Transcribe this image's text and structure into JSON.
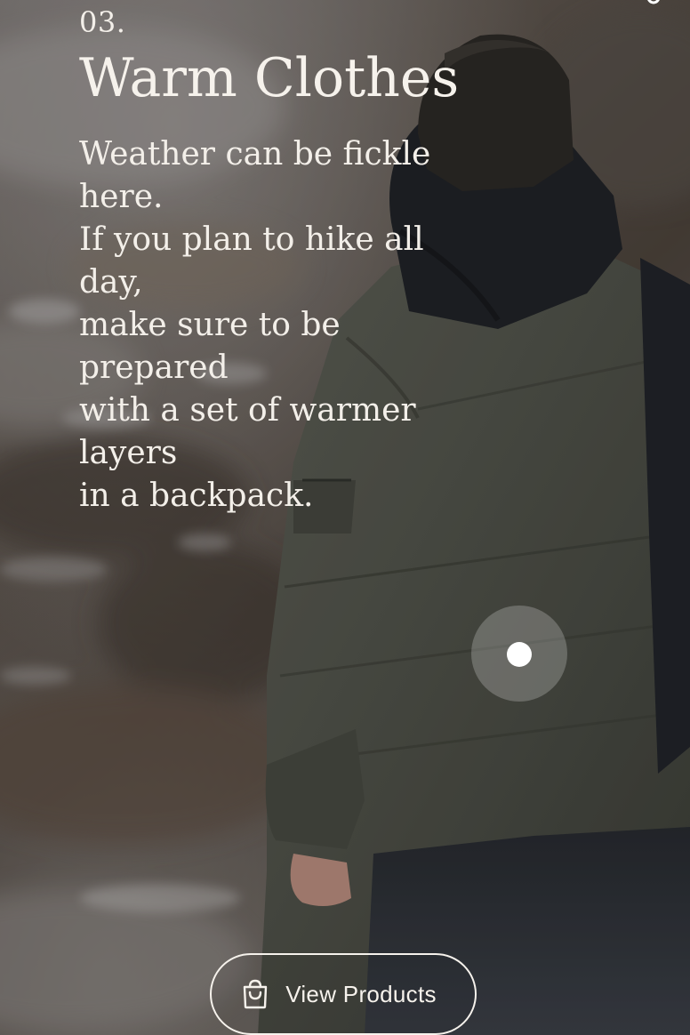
{
  "slide": {
    "step_number": "03.",
    "title": "Warm Clothes",
    "body_lines": [
      "Weather can be fickle here.",
      "If you plan to hike all day,",
      "make sure to be prepared",
      "with a set of warmer layers",
      "in a backpack."
    ]
  },
  "cta": {
    "label": "View Products",
    "icon": "shopping-bag-icon"
  },
  "hotspot": {
    "icon": "hotspot-dot-icon"
  },
  "share": {
    "icon": "share-icon"
  },
  "colors": {
    "text": "#f6f2ec",
    "jacket": "#4d5046",
    "hood": "#1f2226"
  }
}
